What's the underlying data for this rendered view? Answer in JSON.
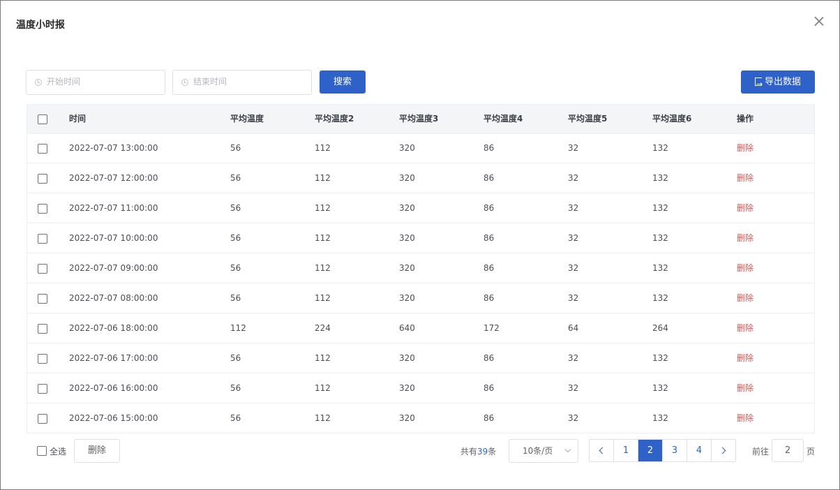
{
  "dialog": {
    "title": "温度小时报"
  },
  "filters": {
    "start_placeholder": "开始时间",
    "end_placeholder": "结束时间",
    "search_label": "搜索",
    "export_label": "导出数据"
  },
  "table": {
    "headers": [
      "时间",
      "平均温度",
      "平均温度2",
      "平均温度3",
      "平均温度4",
      "平均温度5",
      "平均温度6",
      "操作"
    ],
    "rows": [
      {
        "time": "2022-07-07 13:00:00",
        "t1": "56",
        "t2": "112",
        "t3": "320",
        "t4": "86",
        "t5": "32",
        "t6": "132",
        "action": "删除"
      },
      {
        "time": "2022-07-07 12:00:00",
        "t1": "56",
        "t2": "112",
        "t3": "320",
        "t4": "86",
        "t5": "32",
        "t6": "132",
        "action": "删除"
      },
      {
        "time": "2022-07-07 11:00:00",
        "t1": "56",
        "t2": "112",
        "t3": "320",
        "t4": "86",
        "t5": "32",
        "t6": "132",
        "action": "删除"
      },
      {
        "time": "2022-07-07 10:00:00",
        "t1": "56",
        "t2": "112",
        "t3": "320",
        "t4": "86",
        "t5": "32",
        "t6": "132",
        "action": "删除"
      },
      {
        "time": "2022-07-07 09:00:00",
        "t1": "56",
        "t2": "112",
        "t3": "320",
        "t4": "86",
        "t5": "32",
        "t6": "132",
        "action": "删除"
      },
      {
        "time": "2022-07-07 08:00:00",
        "t1": "56",
        "t2": "112",
        "t3": "320",
        "t4": "86",
        "t5": "32",
        "t6": "132",
        "action": "删除"
      },
      {
        "time": "2022-07-06 18:00:00",
        "t1": "112",
        "t2": "224",
        "t3": "640",
        "t4": "172",
        "t5": "64",
        "t6": "264",
        "action": "删除"
      },
      {
        "time": "2022-07-06 17:00:00",
        "t1": "56",
        "t2": "112",
        "t3": "320",
        "t4": "86",
        "t5": "32",
        "t6": "132",
        "action": "删除"
      },
      {
        "time": "2022-07-06 16:00:00",
        "t1": "56",
        "t2": "112",
        "t3": "320",
        "t4": "86",
        "t5": "32",
        "t6": "132",
        "action": "删除"
      },
      {
        "time": "2022-07-06 15:00:00",
        "t1": "56",
        "t2": "112",
        "t3": "320",
        "t4": "86",
        "t5": "32",
        "t6": "132",
        "action": "删除"
      }
    ]
  },
  "footer": {
    "select_all_label": "全选",
    "delete_label": "删除",
    "total_prefix": "共有",
    "total_count": "39",
    "total_suffix": "条",
    "page_size": "10条/页",
    "pages": [
      "1",
      "2",
      "3",
      "4"
    ],
    "current_page": "2",
    "goto_prefix": "前往",
    "goto_value": "2",
    "goto_suffix": "页"
  },
  "colors": {
    "primary": "#2f62c9",
    "danger": "#d9534f",
    "header_bg": "#f4f5f7"
  }
}
